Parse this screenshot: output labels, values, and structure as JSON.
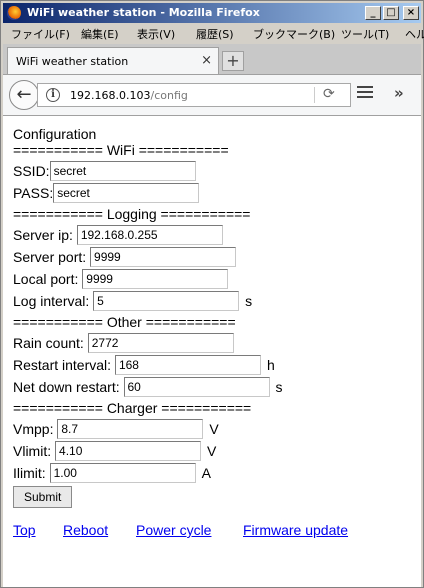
{
  "window": {
    "title": "WiFi weather station - Mozilla Firefox",
    "minimize": "_",
    "maximize": "□",
    "close": "×"
  },
  "menubar": [
    "ファイル(F)",
    "編集(E)",
    "表示(V)",
    "履歴(S)",
    "ブックマーク(B)",
    "ツール(T)",
    "ヘル"
  ],
  "tab": {
    "title": "WiFi weather station",
    "close": "×",
    "new_tab": "+"
  },
  "navbar": {
    "back": "←",
    "url_host": "192.168.0.103",
    "url_path": "/config",
    "reload": "⟳",
    "overflow": "»"
  },
  "page": {
    "heading": "Configuration",
    "wifi_header": "=========== WiFi ===========",
    "ssid_label": "SSID:",
    "ssid_value": "secret",
    "pass_label": "PASS:",
    "pass_value": "secret",
    "logging_header": "=========== Logging ===========",
    "server_ip_label": "Server ip:",
    "server_ip_value": "192.168.0.255",
    "server_port_label": "Server port:",
    "server_port_value": "9999",
    "local_port_label": "Local port:",
    "local_port_value": "9999",
    "log_interval_label": "Log interval:",
    "log_interval_value": "5",
    "log_interval_unit": "s",
    "other_header": "=========== Other ===========",
    "rain_count_label": "Rain count:",
    "rain_count_value": "2772",
    "restart_interval_label": "Restart interval:",
    "restart_interval_value": "168",
    "restart_interval_unit": "h",
    "net_down_label": "Net down restart:",
    "net_down_value": "60",
    "net_down_unit": "s",
    "charger_header": "=========== Charger ===========",
    "vmpp_label": "Vmpp:",
    "vmpp_value": "8.7",
    "vmpp_unit": "V",
    "vlimit_label": "Vlimit:",
    "vlimit_value": "4.10",
    "vlimit_unit": "V",
    "ilimit_label": "Ilimit:",
    "ilimit_value": "1.00",
    "ilimit_unit": "A",
    "submit_label": "Submit"
  },
  "links": [
    "Top",
    "Reboot",
    "Power cycle",
    "Firmware update"
  ],
  "colors": {
    "link": "#0000ee",
    "titlebar": "#0a246a"
  }
}
